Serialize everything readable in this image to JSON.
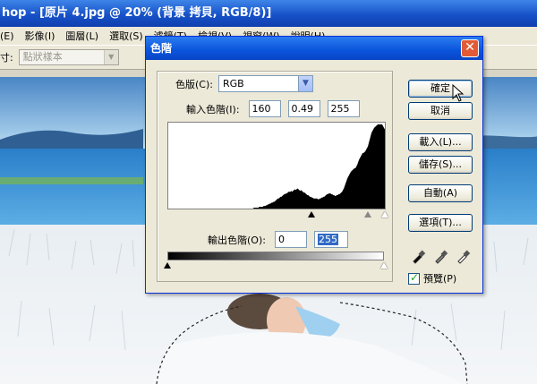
{
  "app": {
    "title": "hop - [原片 4.jpg @ 20% (背景 拷貝, RGB/8)]"
  },
  "menu": {
    "items": [
      "(E)",
      "影像(I)",
      "圖層(L)",
      "選取(S)",
      "濾鏡(T)",
      "檢視(V)",
      "視窗(W)",
      "說明(H)"
    ]
  },
  "options_bar": {
    "label": "寸:",
    "sample_value": "點狀樣本"
  },
  "dialog": {
    "title": "色階",
    "channel_label": "色版(C):",
    "channel_value": "RGB",
    "input_levels_label": "輸入色階(I):",
    "input_black": "160",
    "input_gamma": "0.49",
    "input_white": "255",
    "output_levels_label": "輸出色階(O):",
    "output_black": "0",
    "output_white": "255",
    "buttons": {
      "ok": "確定",
      "cancel": "取消",
      "load": "載入(L)...",
      "save": "儲存(S)...",
      "auto": "自動(A)",
      "options": "選項(T)..."
    },
    "preview_label": "預覽(P)",
    "preview_checked": true
  },
  "histogram": {
    "levels": [
      0,
      0,
      0,
      0,
      0,
      0,
      0,
      0,
      0,
      0,
      0,
      0,
      0,
      0,
      0,
      0,
      0,
      0,
      0,
      0,
      0,
      0,
      0,
      0,
      0,
      0,
      0,
      0,
      0,
      0,
      0,
      0,
      0,
      0,
      0,
      0,
      0,
      0,
      0,
      0,
      0,
      0,
      0,
      0,
      0,
      0,
      0,
      0,
      0,
      0,
      0,
      0,
      0,
      0,
      0,
      0,
      0,
      0,
      0,
      0,
      0,
      0,
      0,
      0,
      0,
      0,
      0,
      0,
      0,
      0,
      0,
      0,
      0,
      0,
      0,
      0,
      0,
      0,
      0,
      0,
      0,
      0,
      0,
      0,
      0,
      0,
      0,
      0,
      0,
      0,
      0,
      0,
      0,
      0,
      0,
      0,
      1,
      1,
      1,
      1,
      1,
      1,
      2,
      2,
      2,
      2,
      2,
      3,
      3,
      3,
      4,
      4,
      5,
      5,
      6,
      6,
      7,
      7,
      8,
      8,
      9,
      10,
      11,
      12,
      12,
      13,
      14,
      14,
      15,
      16,
      17,
      17,
      18,
      18,
      19,
      20,
      20,
      20,
      21,
      20,
      21,
      22,
      23,
      22,
      23,
      24,
      23,
      22,
      21,
      22,
      21,
      20,
      19,
      19,
      18,
      17,
      16,
      16,
      15,
      14,
      14,
      13,
      13,
      12,
      12,
      12,
      12,
      12,
      11,
      11,
      12,
      12,
      13,
      13,
      14,
      14,
      15,
      16,
      17,
      17,
      18,
      18,
      18,
      17,
      17,
      16,
      16,
      15,
      15,
      16,
      16,
      17,
      17,
      18,
      19,
      20,
      22,
      24,
      27,
      30,
      33,
      36,
      38,
      40,
      42,
      44,
      45,
      46,
      47,
      48,
      48,
      50,
      52,
      55,
      58,
      60,
      62,
      64,
      66,
      66,
      67,
      68,
      70,
      72,
      74,
      78,
      82,
      86,
      90,
      92,
      94,
      96,
      97,
      98,
      99,
      100,
      100,
      100,
      100,
      100,
      100,
      98,
      96,
      94
    ]
  }
}
